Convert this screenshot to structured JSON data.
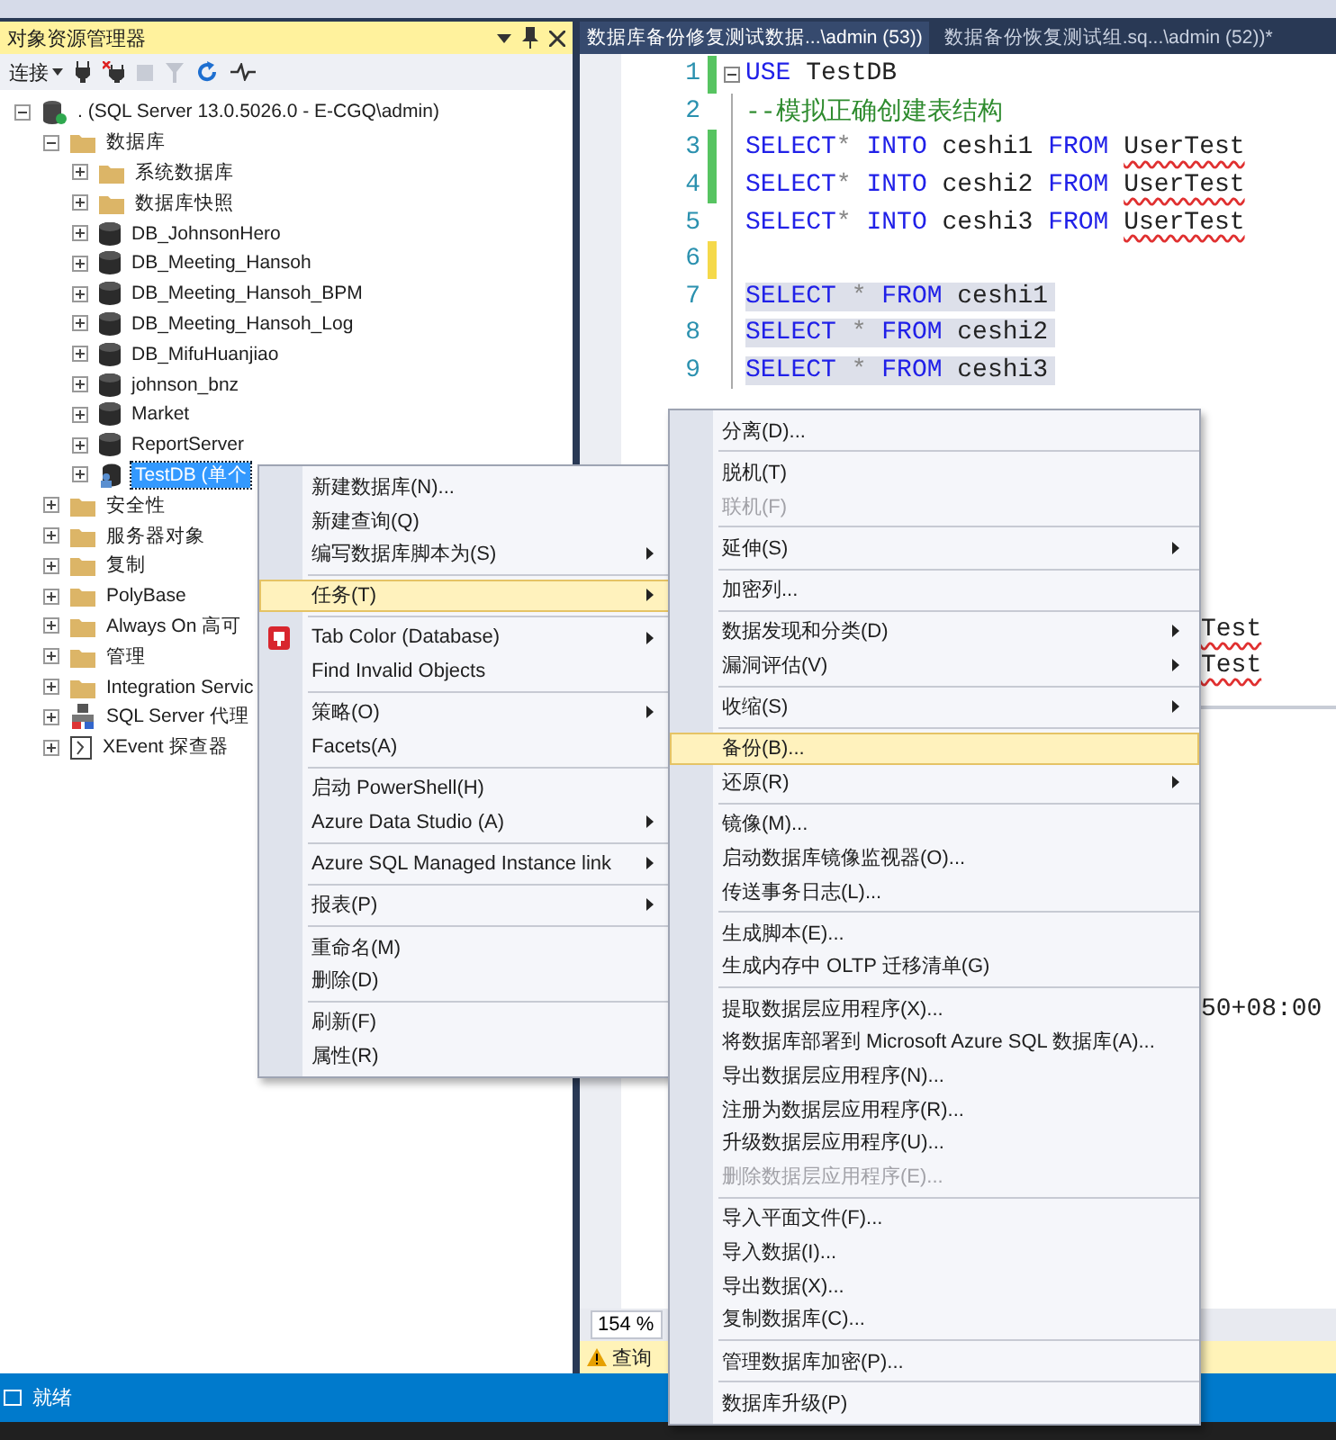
{
  "explorer": {
    "title": "对象资源管理器",
    "connect": "连接",
    "tree": [
      {
        "label": ". (SQL Server 13.0.5026.0 - E-CGQ\\admin)",
        "kind": "server",
        "expanded": true,
        "selected": false,
        "children": [
          {
            "label": "数据库",
            "kind": "folder",
            "expanded": true,
            "selected": false,
            "children": [
              {
                "label": "系统数据库",
                "kind": "folder",
                "expanded": false,
                "selected": false
              },
              {
                "label": "数据库快照",
                "kind": "folder",
                "expanded": false,
                "selected": false
              },
              {
                "label": "DB_JohnsonHero",
                "kind": "database",
                "expanded": false,
                "selected": false
              },
              {
                "label": "DB_Meeting_Hansoh",
                "kind": "database",
                "expanded": false,
                "selected": false
              },
              {
                "label": "DB_Meeting_Hansoh_BPM",
                "kind": "database",
                "expanded": false,
                "selected": false
              },
              {
                "label": "DB_Meeting_Hansoh_Log",
                "kind": "database",
                "expanded": false,
                "selected": false
              },
              {
                "label": "DB_MifuHuanjiao",
                "kind": "database",
                "expanded": false,
                "selected": false
              },
              {
                "label": "johnson_bnz",
                "kind": "database",
                "expanded": false,
                "selected": false
              },
              {
                "label": "Market",
                "kind": "database",
                "expanded": false,
                "selected": false
              },
              {
                "label": "ReportServer",
                "kind": "database",
                "expanded": false,
                "selected": false
              },
              {
                "label": "TestDB (单个",
                "kind": "single_user_database",
                "expanded": false,
                "selected": true
              }
            ]
          },
          {
            "label": "安全性",
            "kind": "folder",
            "expanded": false,
            "selected": false
          },
          {
            "label": "服务器对象",
            "kind": "folder",
            "expanded": false,
            "selected": false
          },
          {
            "label": "复制",
            "kind": "folder",
            "expanded": false,
            "selected": false
          },
          {
            "label": "PolyBase",
            "kind": "folder",
            "expanded": false,
            "selected": false
          },
          {
            "label": "Always On 高可",
            "kind": "folder",
            "expanded": false,
            "selected": false
          },
          {
            "label": "管理",
            "kind": "folder",
            "expanded": false,
            "selected": false
          },
          {
            "label": "Integration Servic",
            "kind": "folder",
            "expanded": false,
            "selected": false
          },
          {
            "label": "SQL Server 代理",
            "kind": "agent",
            "expanded": false,
            "selected": false
          },
          {
            "label": "XEvent 探查器",
            "kind": "xevent",
            "expanded": false,
            "selected": false
          }
        ]
      }
    ]
  },
  "editor": {
    "tabs": [
      {
        "label": "数据库备份修复测试数据...\\admin (53))",
        "selected": true
      },
      {
        "label": "数据备份恢复测试组.sq...\\admin (52))*",
        "selected": false
      }
    ],
    "lines": [
      {
        "number": "1",
        "color": "#57c461",
        "fold": true,
        "highlighted": false,
        "segments": [
          {
            "text": "USE",
            "kind": "keyword"
          },
          {
            "text": " TestDB",
            "kind": "plain"
          }
        ]
      },
      {
        "number": "2",
        "highlighted": false,
        "segments": [
          {
            "text": "--模拟正确创建表结构",
            "kind": "comment"
          }
        ]
      },
      {
        "number": "3",
        "color": "#57c461",
        "highlighted": false,
        "segments": [
          {
            "text": "SELECT",
            "kind": "keyword"
          },
          {
            "text": "* ",
            "kind": "operator"
          },
          {
            "text": "INTO",
            "kind": "keyword"
          },
          {
            "text": " ceshi1 ",
            "kind": "plain"
          },
          {
            "text": "FROM ",
            "kind": "keyword"
          },
          {
            "text": "UserTest",
            "kind": "error"
          }
        ]
      },
      {
        "number": "4",
        "color": "#57c461",
        "highlighted": false,
        "segments": [
          {
            "text": "SELECT",
            "kind": "keyword"
          },
          {
            "text": "* ",
            "kind": "operator"
          },
          {
            "text": "INTO",
            "kind": "keyword"
          },
          {
            "text": " ceshi2 ",
            "kind": "plain"
          },
          {
            "text": "FROM ",
            "kind": "keyword"
          },
          {
            "text": "UserTest",
            "kind": "error"
          }
        ]
      },
      {
        "number": "5",
        "highlighted": false,
        "segments": [
          {
            "text": "SELECT",
            "kind": "keyword"
          },
          {
            "text": "* ",
            "kind": "operator"
          },
          {
            "text": "INTO",
            "kind": "keyword"
          },
          {
            "text": " ceshi3 ",
            "kind": "plain"
          },
          {
            "text": "FROM ",
            "kind": "keyword"
          },
          {
            "text": "UserTest",
            "kind": "error"
          }
        ]
      },
      {
        "number": "6",
        "color": "#f5d94a"
      },
      {
        "number": "7",
        "highlighted": true,
        "segments": [
          {
            "text": "SELECT",
            "kind": "keyword"
          },
          {
            "text": " * ",
            "kind": "operator"
          },
          {
            "text": "FROM",
            "kind": "keyword"
          },
          {
            "text": " ceshi1",
            "kind": "plain"
          }
        ]
      },
      {
        "number": "8",
        "highlighted": true,
        "segments": [
          {
            "text": "SELECT",
            "kind": "keyword"
          },
          {
            "text": " * ",
            "kind": "operator"
          },
          {
            "text": "FROM",
            "kind": "keyword"
          },
          {
            "text": " ceshi2",
            "kind": "plain"
          }
        ]
      },
      {
        "number": "9",
        "highlighted": true,
        "segments": [
          {
            "text": "SELECT",
            "kind": "keyword"
          },
          {
            "text": " * ",
            "kind": "operator"
          },
          {
            "text": "FROM",
            "kind": "keyword"
          },
          {
            "text": " ceshi3",
            "kind": "plain"
          }
        ]
      }
    ],
    "fragments": [
      {
        "text": "Test",
        "kind": "error"
      },
      {
        "text": "Test",
        "kind": "error"
      },
      {
        "text": "50+08:00",
        "kind": "plain"
      }
    ],
    "zoom": "154 %",
    "query_status": "查询"
  },
  "context_menus": [
    {
      "items": [
        {
          "kind": "item",
          "label": "新建数据库(N)...",
          "submenu": false,
          "selected": false,
          "disabled": false
        },
        {
          "kind": "item",
          "label": "新建查询(Q)",
          "submenu": false,
          "selected": false,
          "disabled": false
        },
        {
          "kind": "item",
          "label": "编写数据库脚本为(S)",
          "submenu": true,
          "selected": false,
          "disabled": false
        },
        {
          "kind": "separator"
        },
        {
          "kind": "item",
          "label": "任务(T)",
          "submenu": true,
          "selected": true,
          "disabled": false
        },
        {
          "kind": "separator"
        },
        {
          "kind": "icon_item",
          "label": "Tab Color (Database)",
          "submenu": true,
          "selected": false,
          "disabled": false
        },
        {
          "kind": "item",
          "label": "Find Invalid Objects",
          "submenu": false,
          "selected": false,
          "disabled": false
        },
        {
          "kind": "separator"
        },
        {
          "kind": "item",
          "label": "策略(O)",
          "submenu": true,
          "selected": false,
          "disabled": false
        },
        {
          "kind": "item",
          "label": "Facets(A)",
          "submenu": false,
          "selected": false,
          "disabled": false
        },
        {
          "kind": "separator"
        },
        {
          "kind": "item",
          "label": "启动 PowerShell(H)",
          "submenu": false,
          "selected": false,
          "disabled": false
        },
        {
          "kind": "item",
          "label": "Azure Data Studio (A)",
          "submenu": true,
          "selected": false,
          "disabled": false
        },
        {
          "kind": "separator"
        },
        {
          "kind": "item",
          "label": "Azure SQL Managed Instance link",
          "submenu": true,
          "selected": false,
          "disabled": false
        },
        {
          "kind": "separator"
        },
        {
          "kind": "item",
          "label": "报表(P)",
          "submenu": true,
          "selected": false,
          "disabled": false
        },
        {
          "kind": "separator"
        },
        {
          "kind": "item",
          "label": "重命名(M)",
          "submenu": false,
          "selected": false,
          "disabled": false
        },
        {
          "kind": "item",
          "label": "删除(D)",
          "submenu": false,
          "selected": false,
          "disabled": false
        },
        {
          "kind": "separator"
        },
        {
          "kind": "item",
          "label": "刷新(F)",
          "submenu": false,
          "selected": false,
          "disabled": false
        },
        {
          "kind": "item",
          "label": "属性(R)",
          "submenu": false,
          "selected": false,
          "disabled": false
        }
      ]
    },
    {
      "items": [
        {
          "kind": "item",
          "label": "分离(D)...",
          "submenu": false,
          "selected": false,
          "disabled": false
        },
        {
          "kind": "separator"
        },
        {
          "kind": "item",
          "label": "脱机(T)",
          "submenu": false,
          "selected": false,
          "disabled": false
        },
        {
          "kind": "item",
          "label": "联机(F)",
          "submenu": false,
          "selected": false,
          "disabled": true
        },
        {
          "kind": "separator"
        },
        {
          "kind": "item",
          "label": "延伸(S)",
          "submenu": true,
          "selected": false,
          "disabled": false
        },
        {
          "kind": "separator"
        },
        {
          "kind": "item",
          "label": "加密列...",
          "submenu": false,
          "selected": false,
          "disabled": false
        },
        {
          "kind": "separator"
        },
        {
          "kind": "item",
          "label": "数据发现和分类(D)",
          "submenu": true,
          "selected": false,
          "disabled": false
        },
        {
          "kind": "item",
          "label": "漏洞评估(V)",
          "submenu": true,
          "selected": false,
          "disabled": false
        },
        {
          "kind": "separator"
        },
        {
          "kind": "item",
          "label": "收缩(S)",
          "submenu": true,
          "selected": false,
          "disabled": false
        },
        {
          "kind": "separator"
        },
        {
          "kind": "item",
          "label": "备份(B)...",
          "submenu": false,
          "selected": true,
          "disabled": false
        },
        {
          "kind": "item",
          "label": "还原(R)",
          "submenu": true,
          "selected": false,
          "disabled": false
        },
        {
          "kind": "separator"
        },
        {
          "kind": "item",
          "label": "镜像(M)...",
          "submenu": false,
          "selected": false,
          "disabled": false
        },
        {
          "kind": "item",
          "label": "启动数据库镜像监视器(O)...",
          "submenu": false,
          "selected": false,
          "disabled": false
        },
        {
          "kind": "item",
          "label": "传送事务日志(L)...",
          "submenu": false,
          "selected": false,
          "disabled": false
        },
        {
          "kind": "separator"
        },
        {
          "kind": "item",
          "label": "生成脚本(E)...",
          "submenu": false,
          "selected": false,
          "disabled": false
        },
        {
          "kind": "item",
          "label": "生成内存中 OLTP 迁移清单(G)",
          "submenu": false,
          "selected": false,
          "disabled": false
        },
        {
          "kind": "separator"
        },
        {
          "kind": "item",
          "label": "提取数据层应用程序(X)...",
          "submenu": false,
          "selected": false,
          "disabled": false
        },
        {
          "kind": "item",
          "label": "将数据库部署到 Microsoft Azure SQL 数据库(A)...",
          "submenu": false,
          "selected": false,
          "disabled": false
        },
        {
          "kind": "item",
          "label": "导出数据层应用程序(N)...",
          "submenu": false,
          "selected": false,
          "disabled": false
        },
        {
          "kind": "item",
          "label": "注册为数据层应用程序(R)...",
          "submenu": false,
          "selected": false,
          "disabled": false
        },
        {
          "kind": "item",
          "label": "升级数据层应用程序(U)...",
          "submenu": false,
          "selected": false,
          "disabled": false
        },
        {
          "kind": "item",
          "label": "删除数据层应用程序(E)...",
          "submenu": false,
          "selected": false,
          "disabled": true
        },
        {
          "kind": "separator"
        },
        {
          "kind": "item",
          "label": "导入平面文件(F)...",
          "submenu": false,
          "selected": false,
          "disabled": false
        },
        {
          "kind": "item",
          "label": "导入数据(I)...",
          "submenu": false,
          "selected": false,
          "disabled": false
        },
        {
          "kind": "item",
          "label": "导出数据(X)...",
          "submenu": false,
          "selected": false,
          "disabled": false
        },
        {
          "kind": "item",
          "label": "复制数据库(C)...",
          "submenu": false,
          "selected": false,
          "disabled": false
        },
        {
          "kind": "separator"
        },
        {
          "kind": "item",
          "label": "管理数据库加密(P)...",
          "submenu": false,
          "selected": false,
          "disabled": false
        },
        {
          "kind": "separator"
        },
        {
          "kind": "item",
          "label": "数据库升级(P)",
          "submenu": false,
          "selected": false,
          "disabled": false
        }
      ]
    }
  ],
  "status_bar": {
    "text": "就绪"
  }
}
